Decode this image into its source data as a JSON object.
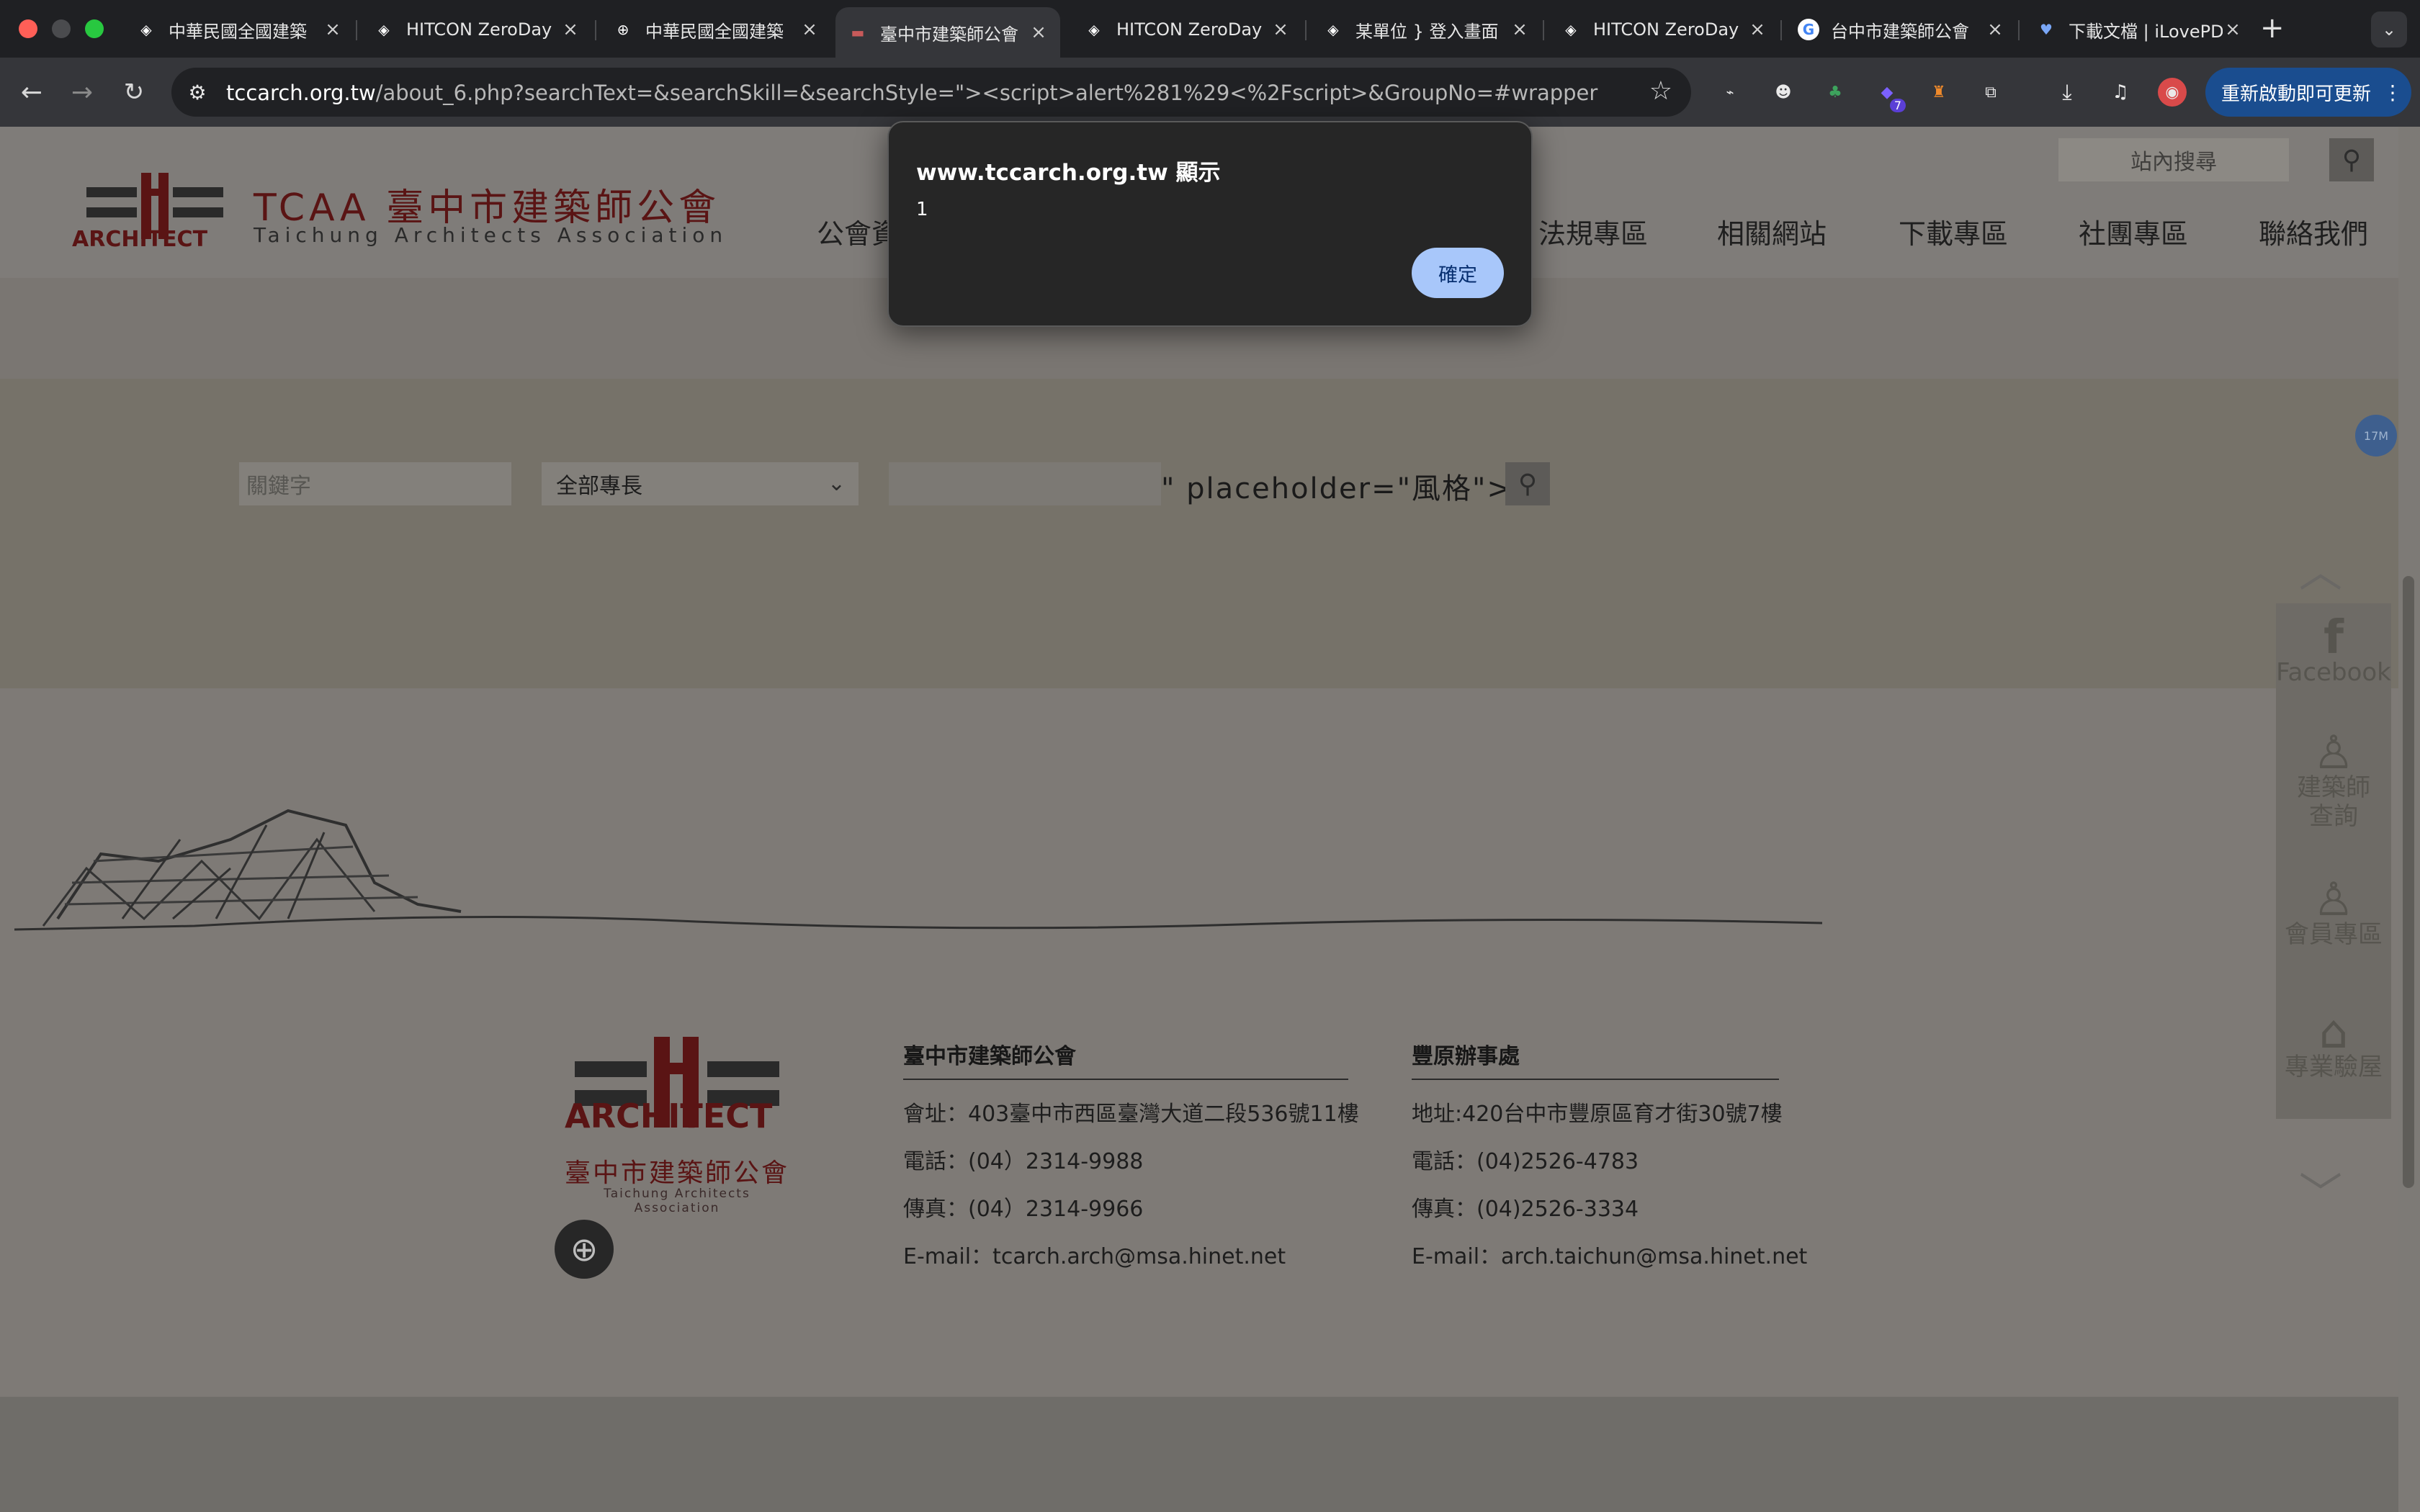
{
  "browser": {
    "tabs": [
      {
        "title": "中華民國全國建築",
        "active": false
      },
      {
        "title": "HITCON ZeroDay",
        "active": false
      },
      {
        "title": "中華民國全國建築",
        "active": false
      },
      {
        "title": "臺中市建築師公會",
        "active": true
      },
      {
        "title": "HITCON ZeroDay",
        "active": false
      },
      {
        "title": "某單位 } 登入畫面",
        "active": false
      },
      {
        "title": "HITCON ZeroDay",
        "active": false
      },
      {
        "title": "台中市建築師公會",
        "active": false
      },
      {
        "title": "下載文檔 | iLovePDF",
        "active": false
      }
    ],
    "url_host": "tccarch.org.tw",
    "url_rest": "/about_6.php?searchText=&searchSkill=&searchStyle=\"><script>alert%281%29<%2Fscript>&GroupNo=#wrapper",
    "extension_badge": "7",
    "update_button": "重新啟動即可更新"
  },
  "alert": {
    "title": "www.tccarch.org.tw 顯示",
    "message": "1",
    "ok_label": "確定"
  },
  "header": {
    "logo_mark": "ARCHITECT",
    "logo_tcaa": "TCAA 臺中市建築師公會",
    "logo_en": "Taichung Architects Association",
    "site_search_placeholder": "站內搜尋",
    "nav": [
      {
        "label": "公會資"
      },
      {
        "label": "法規專區"
      },
      {
        "label": "相關網站"
      },
      {
        "label": "下載專區"
      },
      {
        "label": "社團專區"
      },
      {
        "label": "聯絡我們"
      }
    ]
  },
  "search": {
    "keyword_placeholder": "關鍵字",
    "skill_selected": "全部專長",
    "leaked_text": "\" placeholder=\"風格\">"
  },
  "footer": {
    "logo_mark": "ARCHITECT",
    "logo_cn": "臺中市建築師公會",
    "logo_en": "Taichung Architects Association",
    "main_office": {
      "title": "臺中市建築師公會",
      "address": "會址：403臺中市西區臺灣大道二段536號11樓",
      "phone": "電話：(04）2314-9988",
      "fax": "傳真：(04）2314-9966",
      "email": "E-mail：tcarch.arch@msa.hinet.net"
    },
    "fengyuan_office": {
      "title": "豐原辦事處",
      "address": "地址:420台中市豐原區育才街30號7樓",
      "phone": "電話：(04)2526-4783",
      "fax": "傳真：(04)2526-3334",
      "email": "E-mail：arch.taichun@msa.hinet.net"
    }
  },
  "floating": {
    "facebook": "Facebook",
    "architect_query_1": "建築師",
    "architect_query_2": "查詢",
    "member_area": "會員專區",
    "inspection": "專業驗屋",
    "badge": "17M"
  }
}
